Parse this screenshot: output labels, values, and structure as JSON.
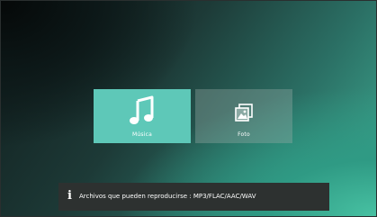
{
  "tiles": [
    {
      "label": "Música",
      "icon": "music-note-icon",
      "selected": true
    },
    {
      "label": "Foto",
      "icon": "photo-gallery-icon",
      "selected": false
    }
  ],
  "info_bar": {
    "icon": "info-icon",
    "text": "Archivos que pueden reproducirse : MP3/FLAC/AAC/WAV"
  },
  "colors": {
    "selected_tile": "#5ec8b8",
    "info_bar_background": "#2d3130"
  }
}
